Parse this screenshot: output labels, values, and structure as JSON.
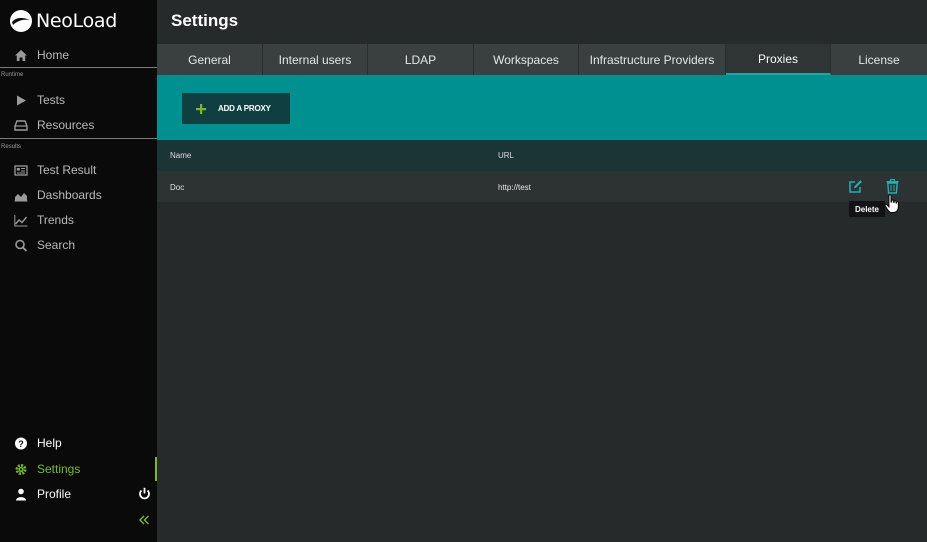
{
  "app": {
    "logo_text": "NeoLoad"
  },
  "sidebar": {
    "home": "Home",
    "runtime_label": "Runtime",
    "runtime": [
      {
        "label": "Tests",
        "icon": "play-icon"
      },
      {
        "label": "Resources",
        "icon": "hdd-icon"
      }
    ],
    "results_label": "Results",
    "results": [
      {
        "label": "Test Result",
        "icon": "list-card-icon"
      },
      {
        "label": "Dashboards",
        "icon": "area-chart-icon"
      },
      {
        "label": "Trends",
        "icon": "line-chart-icon"
      },
      {
        "label": "Search",
        "icon": "search-icon"
      }
    ],
    "bottom": [
      {
        "label": "Help",
        "icon": "help-icon"
      },
      {
        "label": "Settings",
        "icon": "gear-icon",
        "active": true
      },
      {
        "label": "Profile",
        "icon": "user-icon"
      }
    ]
  },
  "page": {
    "title": "Settings",
    "tabs": [
      "General",
      "Internal users",
      "LDAP",
      "Workspaces",
      "Infrastructure Providers",
      "Proxies",
      "License"
    ],
    "active_tab": "Proxies",
    "add_button": "ADD A PROXY",
    "columns": [
      "Name",
      "URL"
    ],
    "rows": [
      {
        "name": "Doc",
        "url": "http://test"
      }
    ],
    "tooltip": "Delete"
  },
  "colors": {
    "accent_green": "#7cbb1e",
    "toolbar_teal": "#00908f",
    "icon_teal": "#1fb3b3"
  }
}
